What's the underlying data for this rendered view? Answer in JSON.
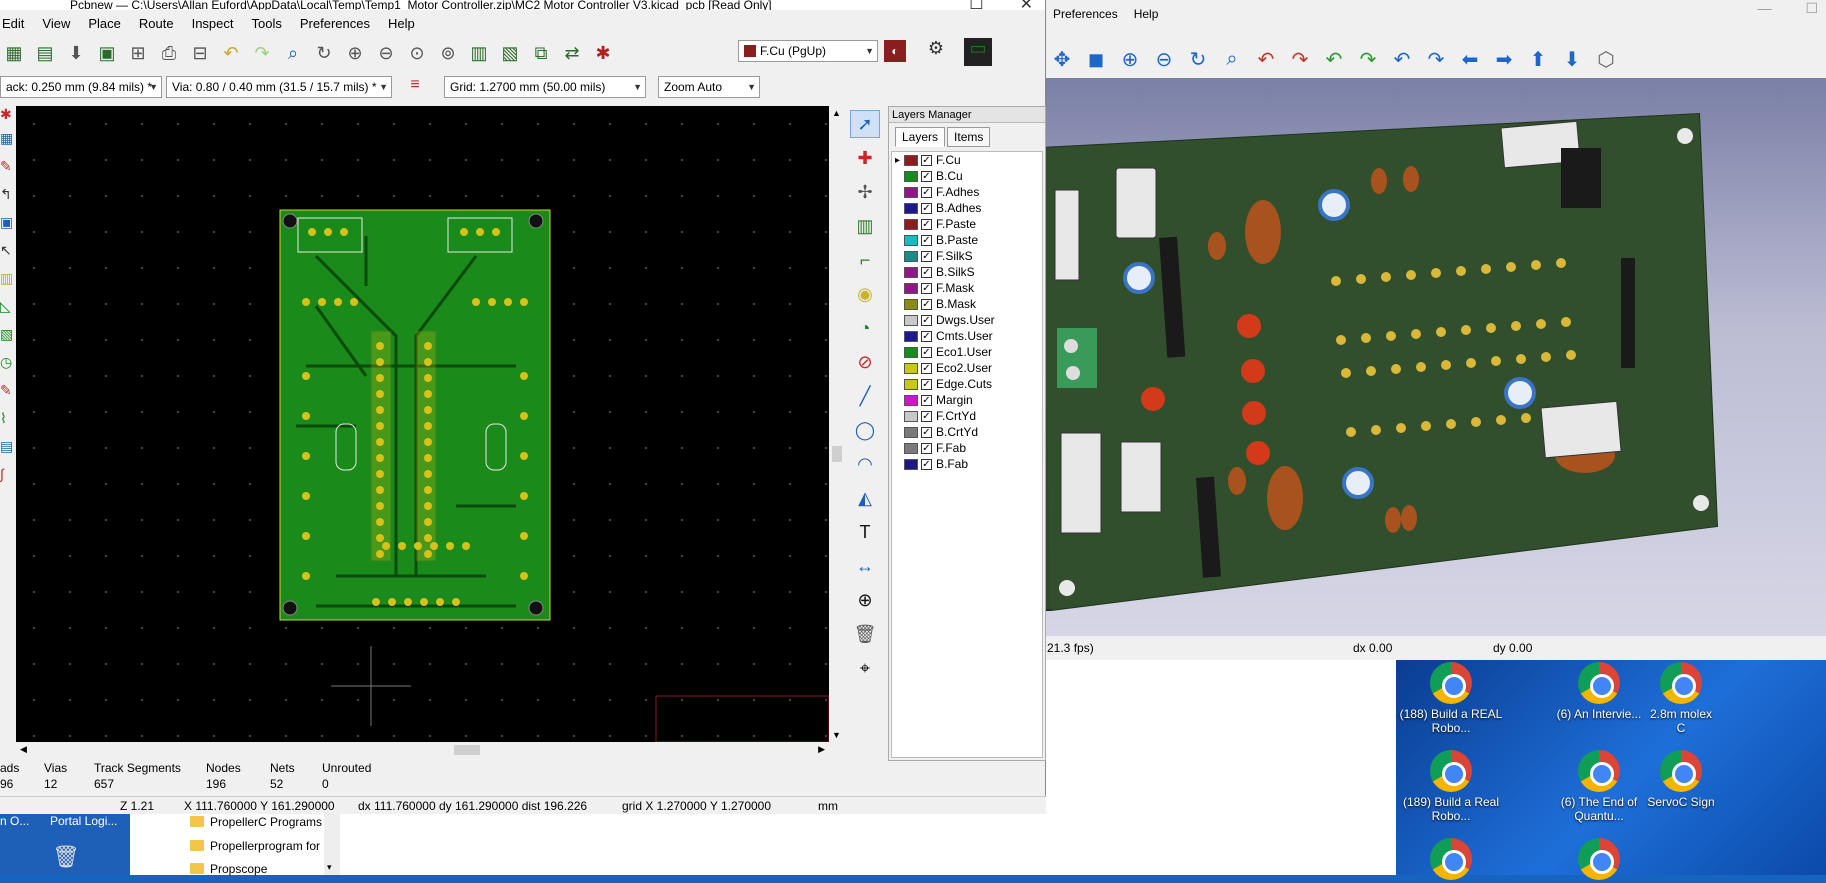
{
  "kicad": {
    "title": "Pcbnew — C:\\Users\\Allan Euford\\AppData\\Local\\Temp\\Temp1_Motor Controller.zip\\MC2 Motor Controller V3.kicad_pcb [Read Only]",
    "menu": [
      "Edit",
      "View",
      "Place",
      "Route",
      "Inspect",
      "Tools",
      "Preferences",
      "Help"
    ],
    "layer_select": "F.Cu (PgUp)",
    "track": "ack: 0.250 mm (9.84 mils) *",
    "via": "Via: 0.80 / 0.40 mm (31.5 / 15.7 mils) *",
    "grid": "Grid: 1.2700 mm (50.00 mils)",
    "zoom": "Zoom Auto",
    "layers_manager": "Layers Manager",
    "tabs": [
      "Layers",
      "Items"
    ],
    "layers": [
      {
        "name": "F.Cu",
        "color": "#8a1d1d"
      },
      {
        "name": "B.Cu",
        "color": "#1a8a1a"
      },
      {
        "name": "F.Adhes",
        "color": "#8a1a8a"
      },
      {
        "name": "B.Adhes",
        "color": "#1a1a8a"
      },
      {
        "name": "F.Paste",
        "color": "#8a1d1d"
      },
      {
        "name": "B.Paste",
        "color": "#20b8c0"
      },
      {
        "name": "F.SilkS",
        "color": "#1a8a8a"
      },
      {
        "name": "B.SilkS",
        "color": "#8a1a8a"
      },
      {
        "name": "F.Mask",
        "color": "#8a1a8a"
      },
      {
        "name": "B.Mask",
        "color": "#8a8a1a"
      },
      {
        "name": "Dwgs.User",
        "color": "#c8c8c8"
      },
      {
        "name": "Cmts.User",
        "color": "#1a1a8a"
      },
      {
        "name": "Eco1.User",
        "color": "#1a8a1a"
      },
      {
        "name": "Eco2.User",
        "color": "#c8c81a"
      },
      {
        "name": "Edge.Cuts",
        "color": "#c8c81a"
      },
      {
        "name": "Margin",
        "color": "#c81ac8"
      },
      {
        "name": "F.CrtYd",
        "color": "#c8c8c8"
      },
      {
        "name": "B.CrtYd",
        "color": "#7a7a7a"
      },
      {
        "name": "F.Fab",
        "color": "#7a7a7a"
      },
      {
        "name": "B.Fab",
        "color": "#1a1a7a"
      }
    ],
    "stats_labels": [
      "ads",
      "Vias",
      "Track Segments",
      "Nodes",
      "Nets",
      "Unrouted"
    ],
    "stats_values": [
      "96",
      "12",
      "657",
      "196",
      "52",
      "0"
    ],
    "status": {
      "z": "Z 1.21",
      "xy": "X 111.760000  Y 161.290000",
      "d": "dx 111.760000  dy 161.290000  dist 196.226",
      "grid": "grid X 1.270000  Y 1.270000",
      "unit": "mm"
    }
  },
  "viewer": {
    "menu": [
      "Preferences",
      "Help"
    ],
    "fps": "21.3 fps)",
    "dx": "dx 0.00",
    "dy": "dy 0.00"
  },
  "desktop": {
    "icons": [
      "(188) Build a REAL Robo...",
      "(6) An Intervie...",
      "2.8m molex C",
      "(189) Build a Real Robo...",
      "(6) The End of Quantu...",
      "ServoC Sign"
    ],
    "folders": [
      "PropellerC Programs",
      "Propellerprogram for b",
      "Propscope"
    ],
    "taskbar_left": "n O...",
    "taskbar_portal": "Portal Logi..."
  }
}
